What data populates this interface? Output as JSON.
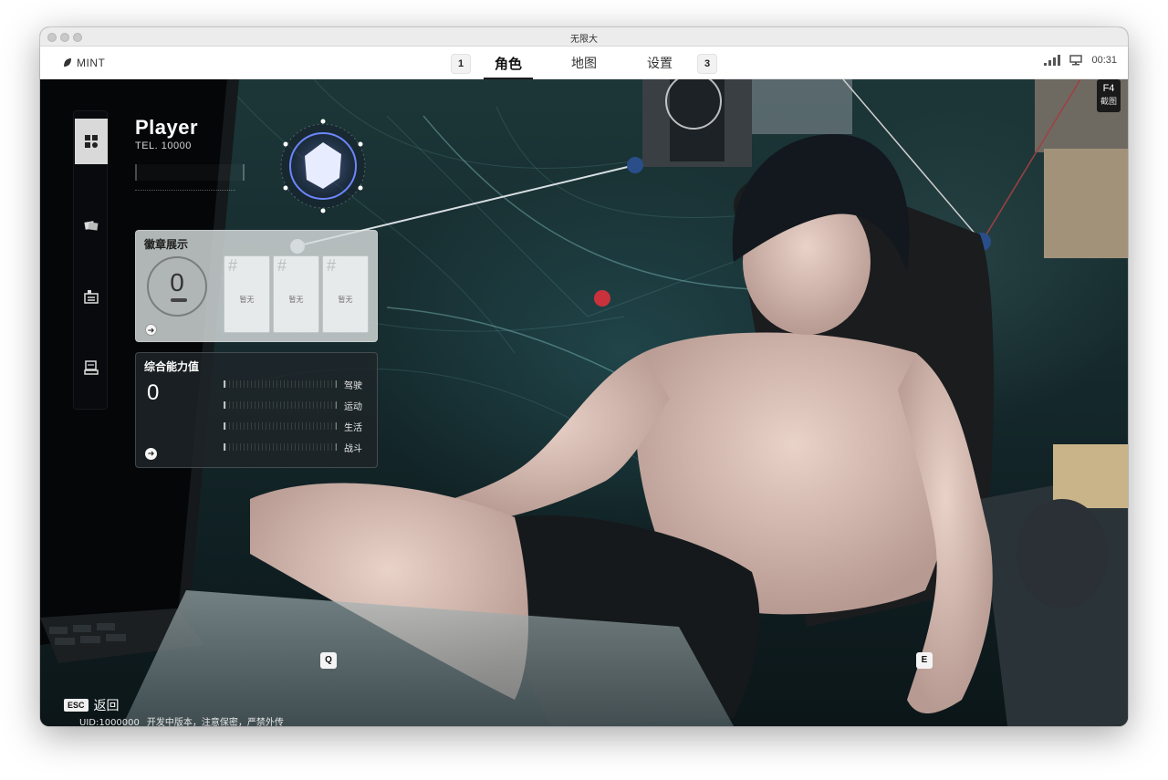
{
  "window": {
    "title": "无限大"
  },
  "nav": {
    "brand": "MINT",
    "left_key": "1",
    "right_key": "3",
    "tabs": [
      {
        "label": "角色",
        "active": true
      },
      {
        "label": "地图",
        "active": false
      },
      {
        "label": "设置",
        "active": false
      }
    ]
  },
  "status": {
    "time": "00:31",
    "icons": [
      "signal-icon",
      "monitor-icon"
    ]
  },
  "screenshot_hint": {
    "key": "F4",
    "label": "截图"
  },
  "sidebar": {
    "items": [
      {
        "icon": "character-grid-icon",
        "active": true
      },
      {
        "icon": "cards-icon",
        "active": false
      },
      {
        "icon": "inbox-icon",
        "active": false
      },
      {
        "icon": "computer-icon",
        "active": false
      }
    ]
  },
  "player": {
    "name": "Player",
    "tel": "TEL. 10000"
  },
  "radar": {
    "icons": [
      "drive-stat-icon",
      "sport-stat-icon",
      "life-stat-icon",
      "combat-stat-icon",
      "charm-stat-icon",
      "skill-stat-icon"
    ]
  },
  "badges": {
    "title": "徽章展示",
    "count": "0",
    "slots": [
      {
        "text": "暂无"
      },
      {
        "text": "暂无"
      },
      {
        "text": "暂无"
      }
    ]
  },
  "ability": {
    "title": "综合能力值",
    "value": "0",
    "stats": [
      {
        "label": "驾驶",
        "value": 0
      },
      {
        "label": "运动",
        "value": 0
      },
      {
        "label": "生活",
        "value": 0
      },
      {
        "label": "战斗",
        "value": 0
      }
    ]
  },
  "keys": {
    "prev": "Q",
    "next": "E"
  },
  "back": {
    "key": "ESC",
    "label": "返回"
  },
  "footer": {
    "uid": "UID:1000000",
    "notice": "开发中版本，注意保密，严禁外传"
  },
  "colors": {
    "accent": "#1b1b1b",
    "scene_dark": "#0f1e21",
    "scene_teal": "#1c3638",
    "map_pin_red": "#c9323c",
    "map_pin_blue": "#2a4e8a"
  }
}
